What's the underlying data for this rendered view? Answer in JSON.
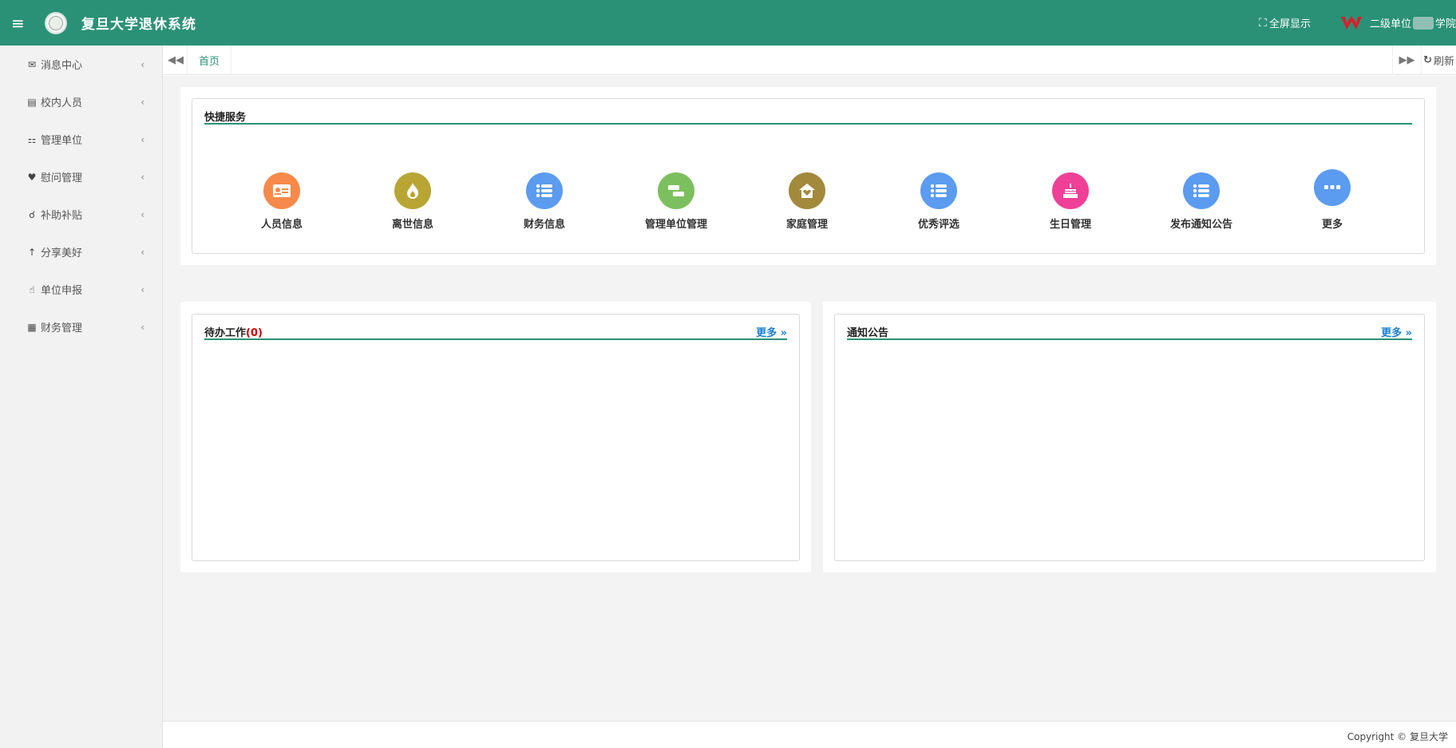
{
  "header": {
    "title": "复旦大学退休系统",
    "fullscreen_label": "全屏显示",
    "unit_prefix": "二级单位",
    "unit_suffix": "学院",
    "bg_color": "#2b9176",
    "logo_color": "#d81e2c"
  },
  "sidebar": {
    "items": [
      {
        "label": "消息中心",
        "icon": "envelope-icon"
      },
      {
        "label": "校内人员",
        "icon": "id-card-icon"
      },
      {
        "label": "管理单位",
        "icon": "sitemap-icon"
      },
      {
        "label": "慰问管理",
        "icon": "heartbeat-icon"
      },
      {
        "label": "补助补贴",
        "icon": "hands-icon"
      },
      {
        "label": "分享美好",
        "icon": "arrow-up-icon"
      },
      {
        "label": "单位申报",
        "icon": "hand-pointer-icon"
      },
      {
        "label": "财务管理",
        "icon": "calculator-icon"
      }
    ]
  },
  "tabs": {
    "active": "首页",
    "refresh_label": "刷新"
  },
  "quick": {
    "title": "快捷服务",
    "items": [
      {
        "label": "人员信息",
        "icon": "id-card-icon",
        "color": "#f7894a"
      },
      {
        "label": "离世信息",
        "icon": "fire-icon",
        "color": "#b8a534"
      },
      {
        "label": "财务信息",
        "icon": "list-icon",
        "color": "#5b9bf0"
      },
      {
        "label": "管理单位管理",
        "icon": "org-chart-icon",
        "color": "#7cbf5e"
      },
      {
        "label": "家庭管理",
        "icon": "home-heart-icon",
        "color": "#a2893c"
      },
      {
        "label": "优秀评选",
        "icon": "list-icon",
        "color": "#5b9bf0"
      },
      {
        "label": "生日管理",
        "icon": "birthday-cake-icon",
        "color": "#f03f96"
      },
      {
        "label": "发布通知公告",
        "icon": "list-icon",
        "color": "#5b9bf0"
      },
      {
        "label": "更多",
        "icon": "ellipsis-icon",
        "color": "#5b9bf0"
      }
    ]
  },
  "todo": {
    "title": "待办工作",
    "count": "(0)",
    "more": "更多 »"
  },
  "notice": {
    "title": "通知公告",
    "more": "更多 »"
  },
  "footer": {
    "copyright": "Copyright © 复旦大学"
  }
}
